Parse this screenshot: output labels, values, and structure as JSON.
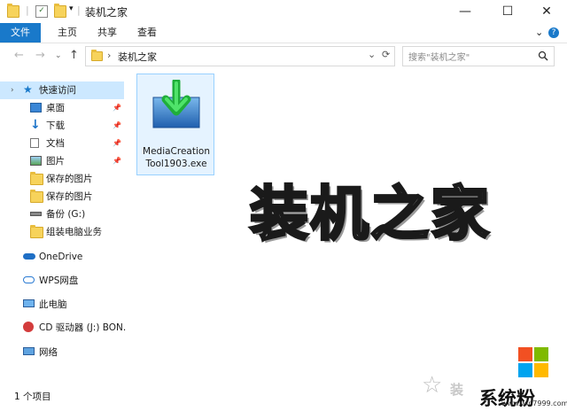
{
  "window": {
    "title": "装机之家",
    "controls": {
      "minimize": "—",
      "maximize": "☐",
      "close": "✕"
    }
  },
  "ribbon": {
    "tabs": [
      {
        "label": "文件"
      },
      {
        "label": "主页"
      },
      {
        "label": "共享"
      },
      {
        "label": "查看"
      }
    ],
    "expand_glyph": "⌄",
    "help_glyph": "?"
  },
  "address": {
    "crumb_sep": "›",
    "path": "装机之家",
    "dropdown_glyph": "⌄",
    "refresh_glyph": "⟳"
  },
  "search": {
    "placeholder": "搜索\"装机之家\""
  },
  "sidebar": {
    "items": [
      {
        "label": "快速访问",
        "icon": "star-icon"
      },
      {
        "label": "桌面",
        "icon": "desktop-icon",
        "pinned": true
      },
      {
        "label": "下载",
        "icon": "download-icon",
        "pinned": true
      },
      {
        "label": "文档",
        "icon": "document-icon",
        "pinned": true
      },
      {
        "label": "图片",
        "icon": "picture-icon",
        "pinned": true
      },
      {
        "label": "保存的图片",
        "icon": "folder-icon"
      },
      {
        "label": "保存的图片",
        "icon": "folder-icon"
      },
      {
        "label": "备份 (G:)",
        "icon": "drive-icon"
      },
      {
        "label": "组装电脑业务",
        "icon": "folder-icon"
      },
      {
        "label": "OneDrive",
        "icon": "cloud-icon"
      },
      {
        "label": "WPS网盘",
        "icon": "wps-cloud-icon"
      },
      {
        "label": "此电脑",
        "icon": "computer-icon"
      },
      {
        "label": "CD 驱动器 (J:) BON.",
        "icon": "cd-drive-icon"
      },
      {
        "label": "网络",
        "icon": "network-icon"
      }
    ]
  },
  "files": [
    {
      "name_line1": "MediaCreation",
      "name_line2": "Tool1903.exe",
      "icon": "media-creation-tool-icon"
    }
  ],
  "watermark": {
    "text": "装机之家"
  },
  "status": {
    "count_text": "1 个项目"
  },
  "branding": {
    "site_name": "系统粉",
    "site_url": "www.win7999.com"
  },
  "colors": {
    "accent": "#1979ca",
    "selection": "#cce8ff",
    "file_select": "#e5f3ff"
  }
}
